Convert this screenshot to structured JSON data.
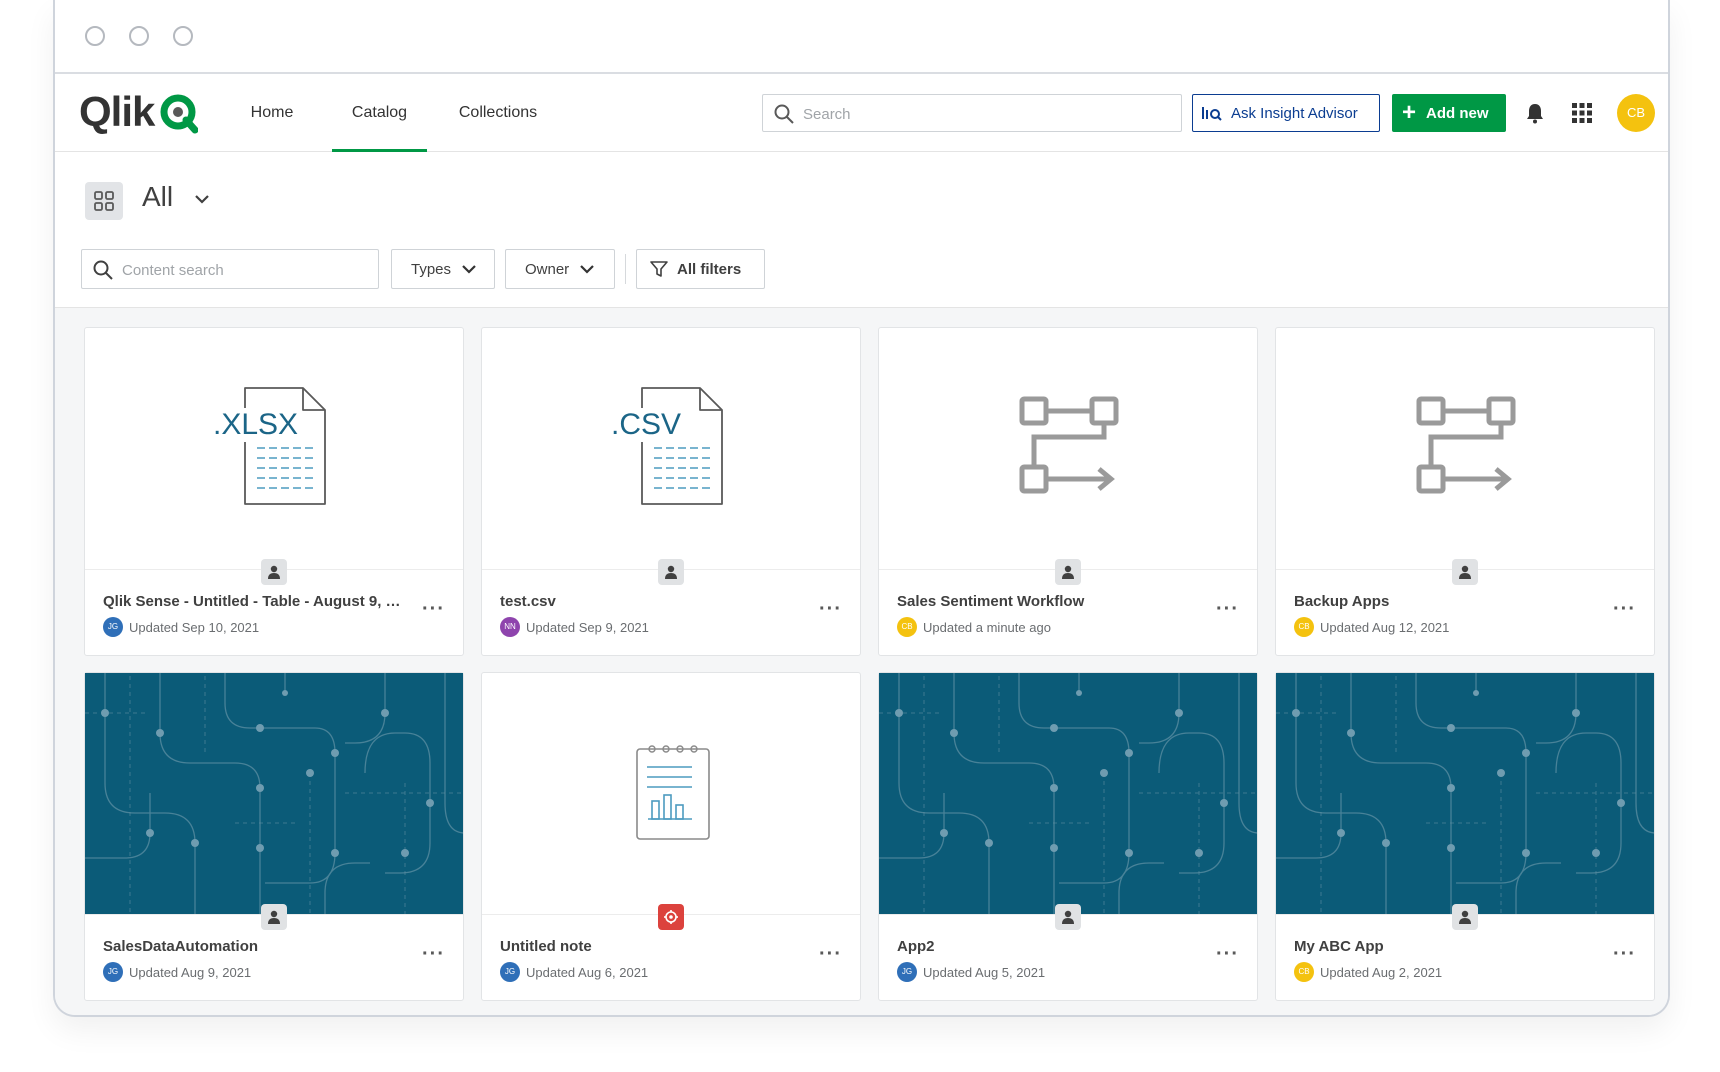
{
  "window": {
    "controls": [
      "close",
      "minimize",
      "maximize"
    ]
  },
  "nav": {
    "logo_text": "Qlik",
    "tabs": [
      {
        "label": "Home",
        "active": false
      },
      {
        "label": "Catalog",
        "active": true
      },
      {
        "label": "Collections",
        "active": false
      }
    ],
    "search_placeholder": "Search",
    "ask_label": "Ask Insight Advisor",
    "add_label": "Add new",
    "user_initials": "CB",
    "icons": [
      "search-icon",
      "insight-advisor-icon",
      "plus-icon",
      "bell-icon",
      "apps-grid-icon"
    ]
  },
  "toolbar": {
    "view_title": "All",
    "content_search_placeholder": "Content search",
    "types_label": "Types",
    "owner_label": "Owner",
    "all_filters_label": "All filters"
  },
  "colors": {
    "accent": "#009845",
    "brand_blue": "#0b3d91",
    "teal_thumb": "#0b5b78"
  },
  "cards": [
    {
      "title": "Qlik Sense - Untitled - Table - August 9, 2...",
      "updated": "Updated Sep 10, 2021",
      "owner_initials": "JG",
      "owner_color": "#2f6fb8",
      "thumb": "xlsx",
      "thumb_label": ".XLSX",
      "badge": "person-icon"
    },
    {
      "title": "test.csv",
      "updated": "Updated Sep 9, 2021",
      "owner_initials": "NN",
      "owner_color": "#8e44ad",
      "thumb": "csv",
      "thumb_label": ".CSV",
      "badge": "person-icon"
    },
    {
      "title": "Sales Sentiment Workflow",
      "updated": "Updated a minute ago",
      "owner_initials": "CB",
      "owner_color": "#f4c20f",
      "thumb": "workflow",
      "badge": "person-icon"
    },
    {
      "title": "Backup Apps",
      "updated": "Updated Aug 12, 2021",
      "owner_initials": "CB",
      "owner_color": "#f4c20f",
      "thumb": "workflow",
      "badge": "person-icon"
    },
    {
      "title": "SalesDataAutomation",
      "updated": "Updated Aug 9, 2021",
      "owner_initials": "JG",
      "owner_color": "#2f6fb8",
      "thumb": "teal",
      "badge": "person-icon"
    },
    {
      "title": "Untitled note",
      "updated": "Updated Aug 6, 2021",
      "owner_initials": "JG",
      "owner_color": "#2f6fb8",
      "thumb": "note",
      "badge": "note-badge-icon"
    },
    {
      "title": "App2",
      "updated": "Updated Aug 5, 2021",
      "owner_initials": "JG",
      "owner_color": "#2f6fb8",
      "thumb": "teal",
      "badge": "person-icon"
    },
    {
      "title": "My ABC App",
      "updated": "Updated Aug 2, 2021",
      "owner_initials": "CB",
      "owner_color": "#f4c20f",
      "thumb": "teal",
      "badge": "person-icon"
    }
  ]
}
